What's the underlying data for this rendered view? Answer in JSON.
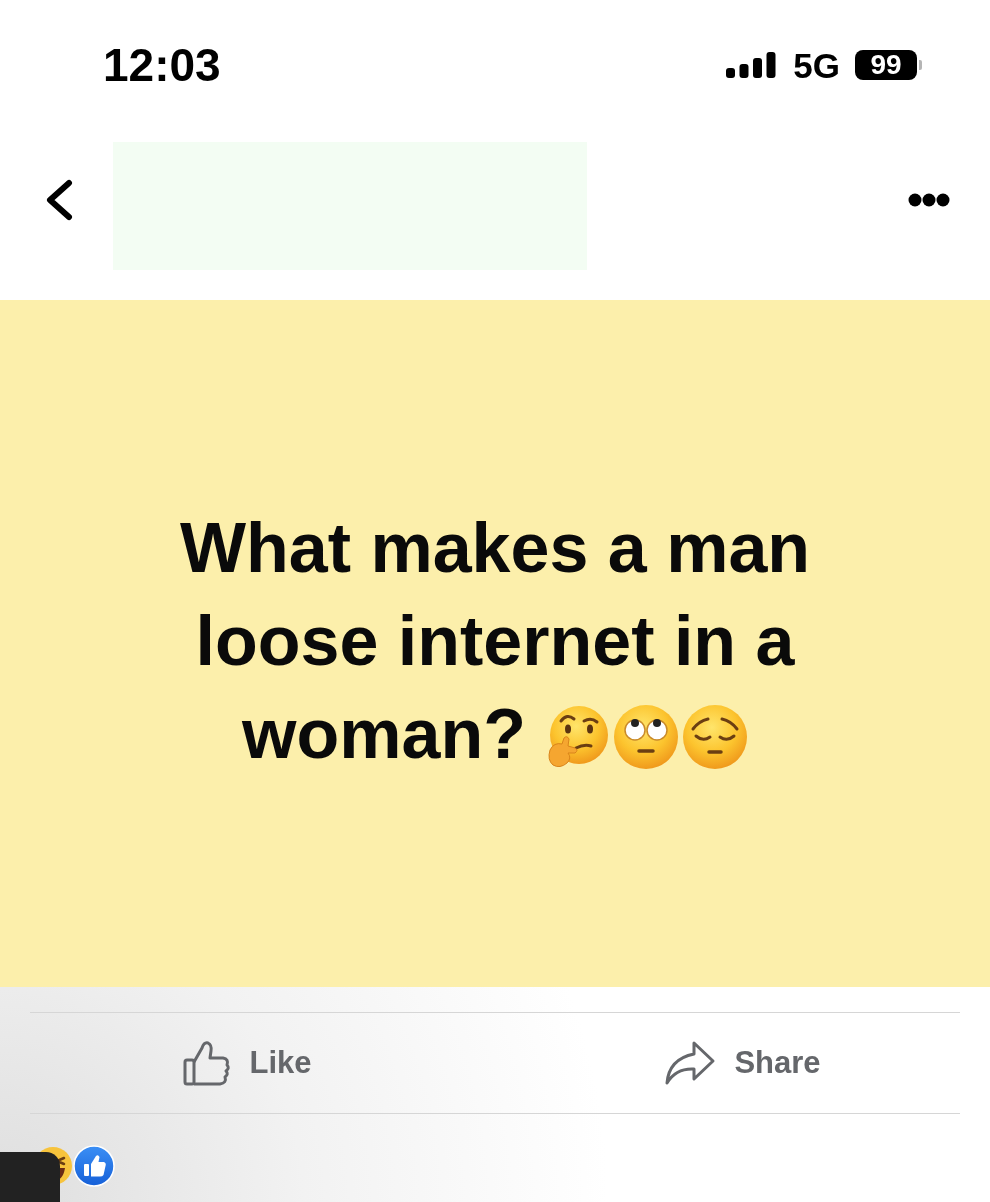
{
  "status_bar": {
    "time": "12:03",
    "network": "5G",
    "battery": "99"
  },
  "post": {
    "lines": [
      "What makes a man",
      "loose internet in a",
      "woman?"
    ]
  },
  "actions": [
    {
      "kind": "like",
      "label": "Like"
    },
    {
      "kind": "share",
      "label": "Share"
    }
  ]
}
